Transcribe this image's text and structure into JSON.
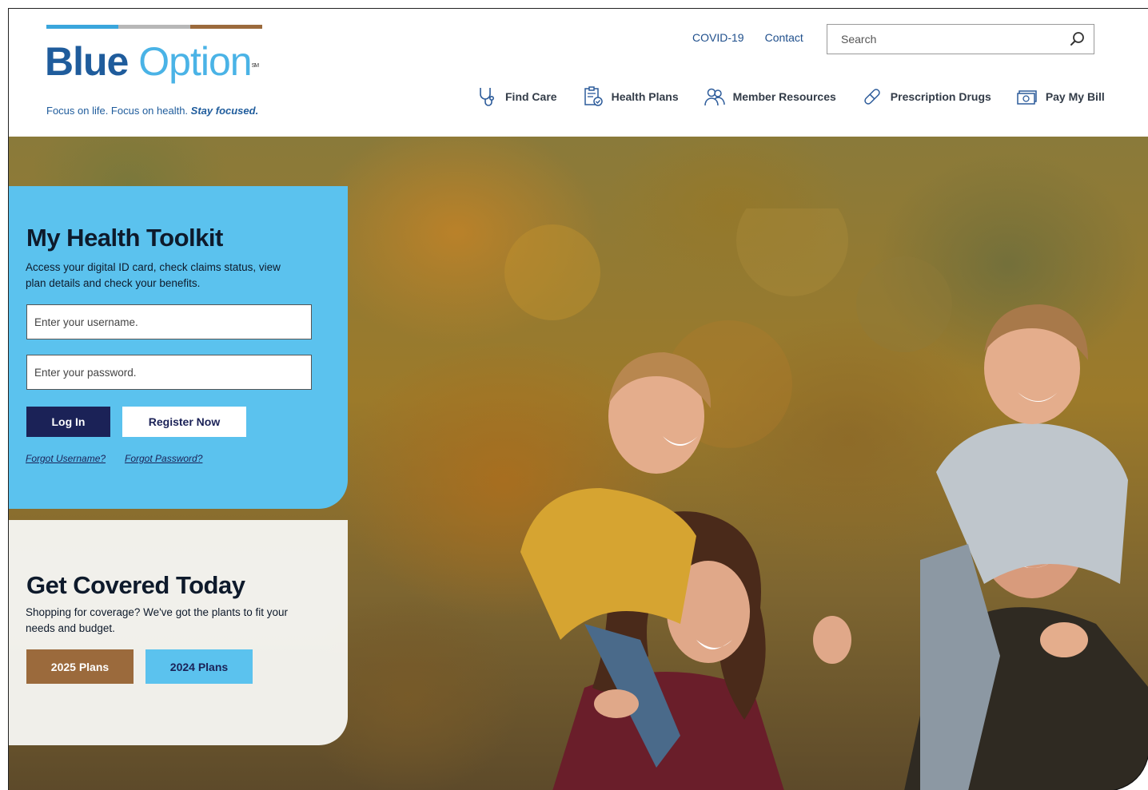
{
  "brand": {
    "logo_word1": "Blue",
    "logo_word2": "Option",
    "logo_mark": "SM",
    "tagline": "Focus on life. Focus on health.",
    "tagline_emphasis": "Stay focused.",
    "bar_colors": [
      "#3aa6dc",
      "#b7b7b7",
      "#9b6a3c"
    ],
    "primary_color": "#1f5c9c",
    "accent_color": "#4ab3e6"
  },
  "utility_nav": [
    {
      "label": "COVID-19"
    },
    {
      "label": "Contact"
    }
  ],
  "search": {
    "placeholder": "Search",
    "icon": "search-icon"
  },
  "main_nav": [
    {
      "label": "Find Care",
      "icon": "stethoscope-icon"
    },
    {
      "label": "Health Plans",
      "icon": "clipboard-icon"
    },
    {
      "label": "Member Resources",
      "icon": "people-icon"
    },
    {
      "label": "Prescription Drugs",
      "icon": "pill-icon"
    },
    {
      "label": "Pay My Bill",
      "icon": "money-icon"
    }
  ],
  "toolkit": {
    "title": "My Health Toolkit",
    "description": "Access your digital ID card, check claims status, view plan details and check your benefits.",
    "username_placeholder": "Enter your username.",
    "password_placeholder": "Enter your password.",
    "login_label": "Log In",
    "register_label": "Register Now",
    "forgot_username": "Forgot Username?",
    "forgot_password": "Forgot Password?",
    "panel_color": "#5bc2ee",
    "login_color": "#1b2257"
  },
  "coverage": {
    "title": "Get Covered Today",
    "description": "Shopping for coverage? We've got the plants to fit your needs and budget.",
    "btn_2025": "2025 Plans",
    "btn_2024": "2024 Plans",
    "btn_2025_color": "#9b6a3c",
    "btn_2024_color": "#5bc2ee"
  }
}
